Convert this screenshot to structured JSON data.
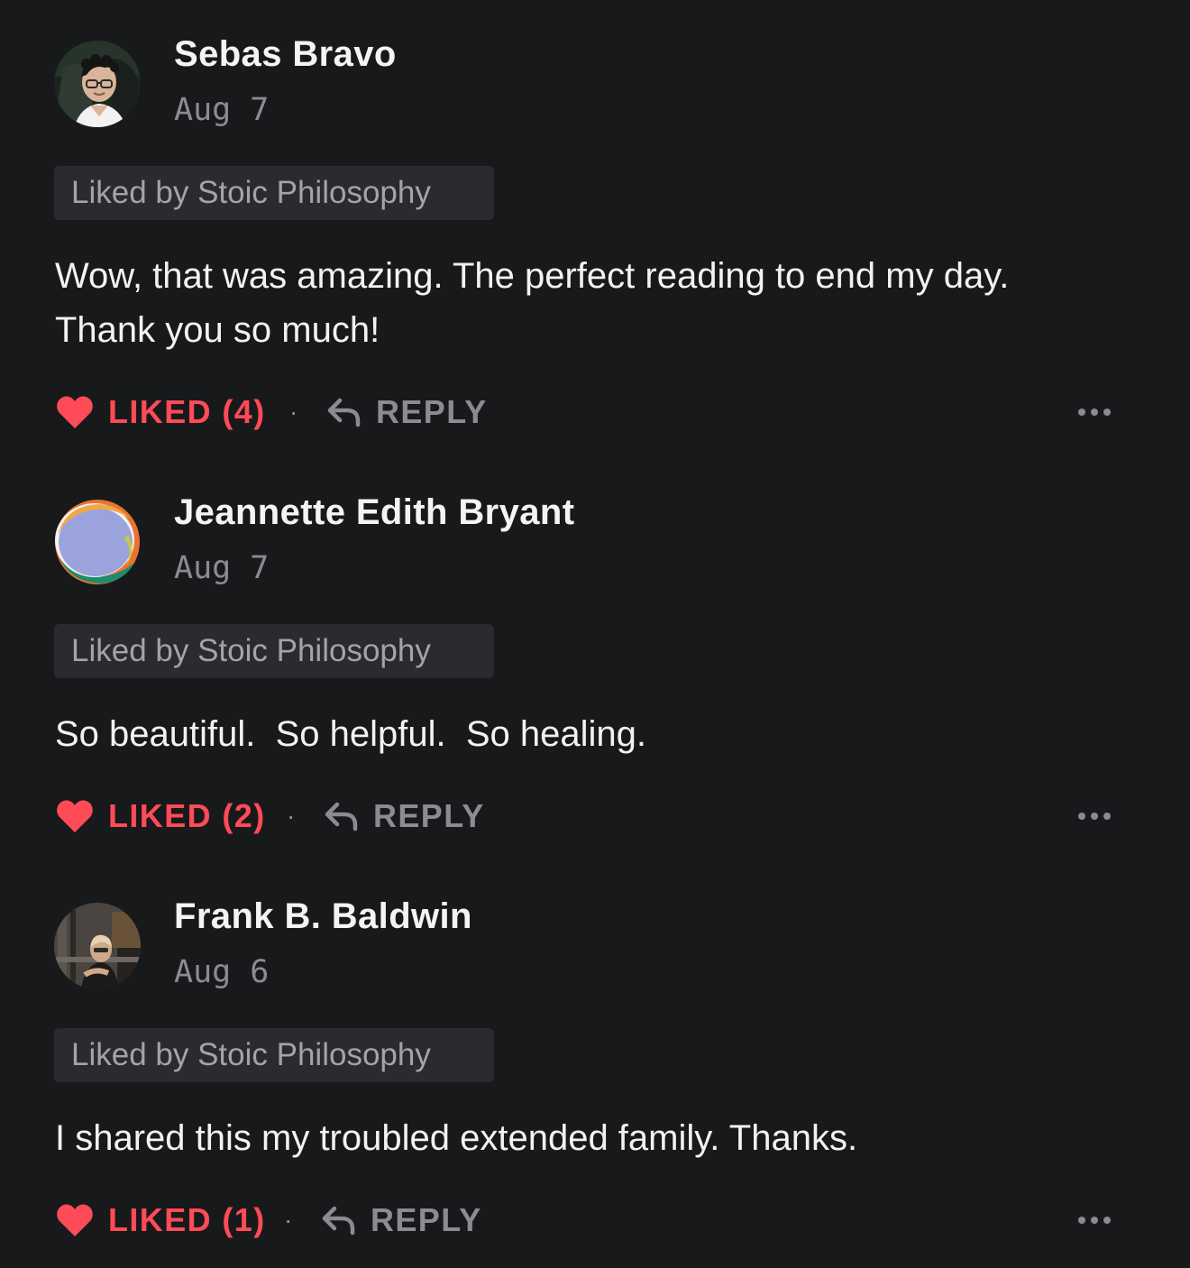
{
  "comments": [
    {
      "author": "Sebas Bravo",
      "date": "Aug 7",
      "liked_by": "Liked by Stoic Philosophy",
      "body": "Wow, that was amazing. The perfect reading to end my day.\nThank you so much!",
      "like_label": "LIKED (4)",
      "separator": "·",
      "reply_label": "REPLY",
      "avatar": "photo-avatar"
    },
    {
      "author": "Jeannette Edith Bryant",
      "date": "Aug 7",
      "liked_by": "Liked by Stoic Philosophy",
      "body": "So beautiful.  So helpful.  So healing.",
      "like_label": "LIKED (2)",
      "separator": "·",
      "reply_label": "REPLY",
      "avatar": "generated-avatar"
    },
    {
      "author": "Frank B. Baldwin",
      "date": "Aug 6",
      "liked_by": "Liked by Stoic Philosophy",
      "body": "I shared this my troubled extended family. Thanks.",
      "like_label": "LIKED (1)",
      "separator": "·",
      "reply_label": "REPLY",
      "avatar": "photo-avatar"
    }
  ],
  "icons": {
    "like": "heart-icon",
    "reply": "reply-arrow-icon",
    "more": "more-options-icon"
  },
  "colors": {
    "background": "#18191b",
    "liked": "#ff4b57",
    "muted": "#8b8c90",
    "tag_background": "#2a2b2e"
  }
}
